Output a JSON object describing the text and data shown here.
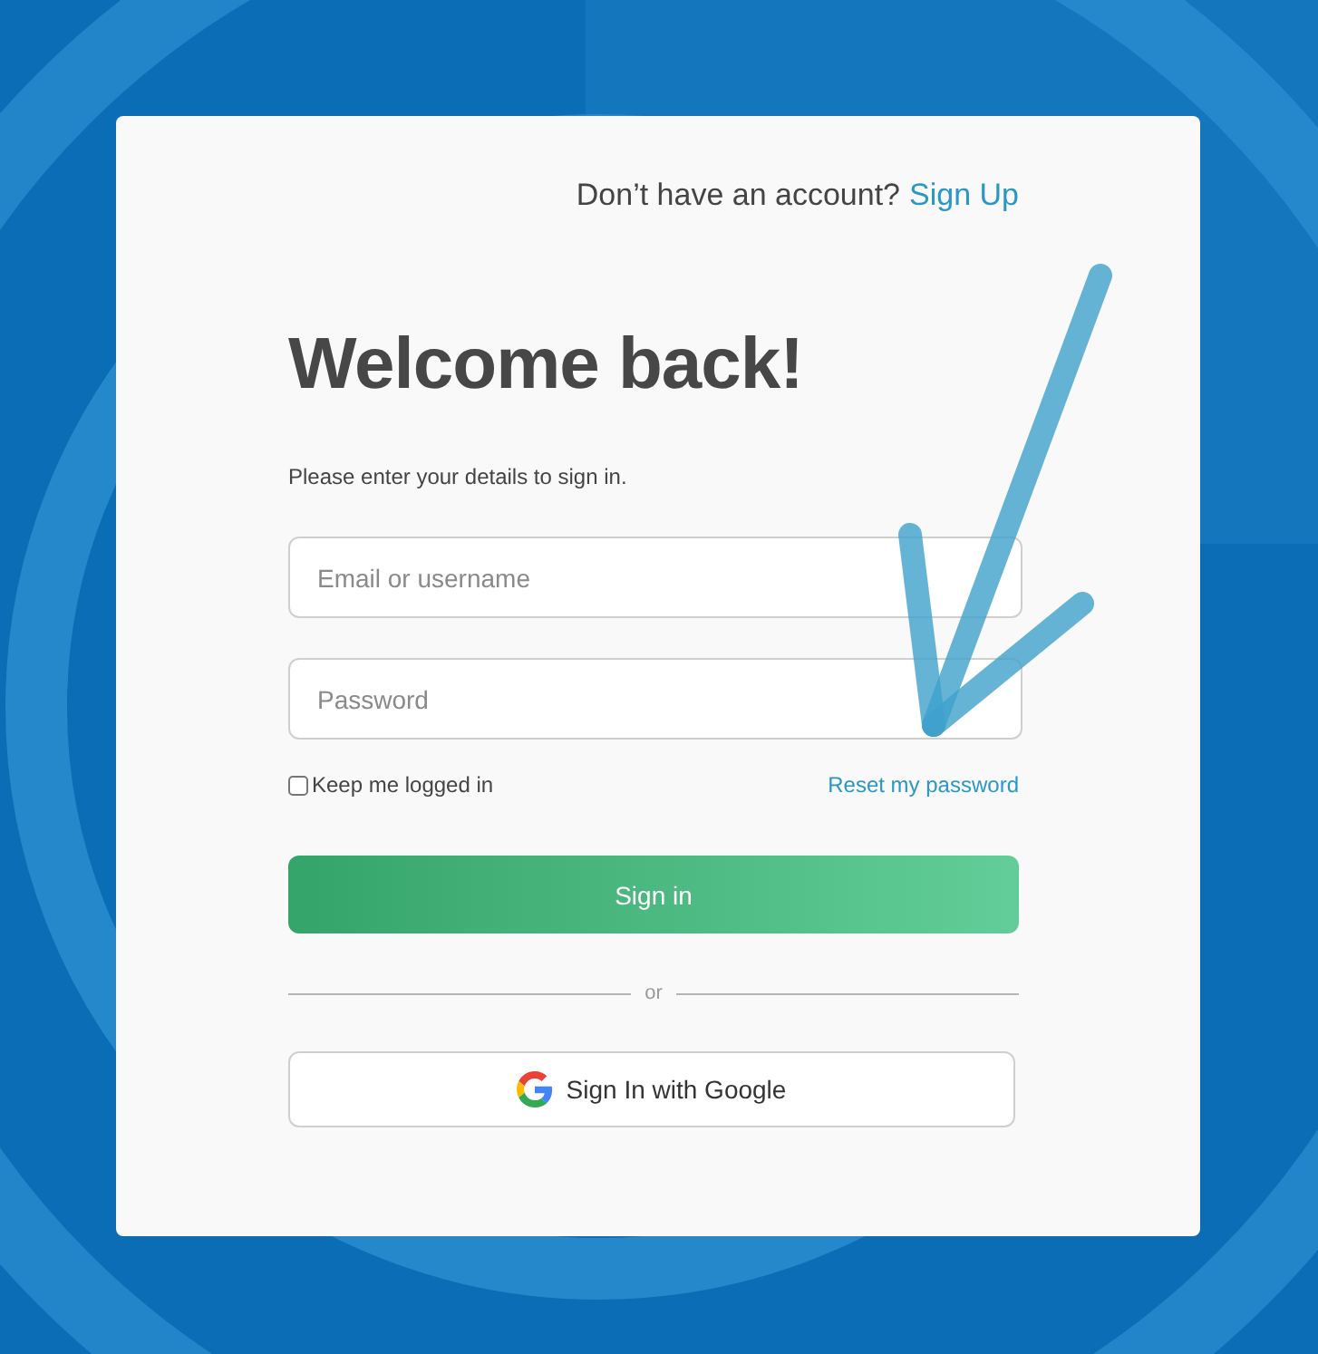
{
  "signup_prompt": {
    "text": "Don’t have an account?",
    "link": "Sign Up"
  },
  "title": "Welcome back!",
  "subtitle": "Please enter your details to sign in.",
  "fields": [
    {
      "placeholder": "Email or username"
    },
    {
      "placeholder": "Password"
    }
  ],
  "remember": {
    "label": "Keep me logged in",
    "checked": false
  },
  "reset_link": "Reset my password",
  "submit_button": "Sign in",
  "divider": "or",
  "google_button": "Sign In with Google"
}
